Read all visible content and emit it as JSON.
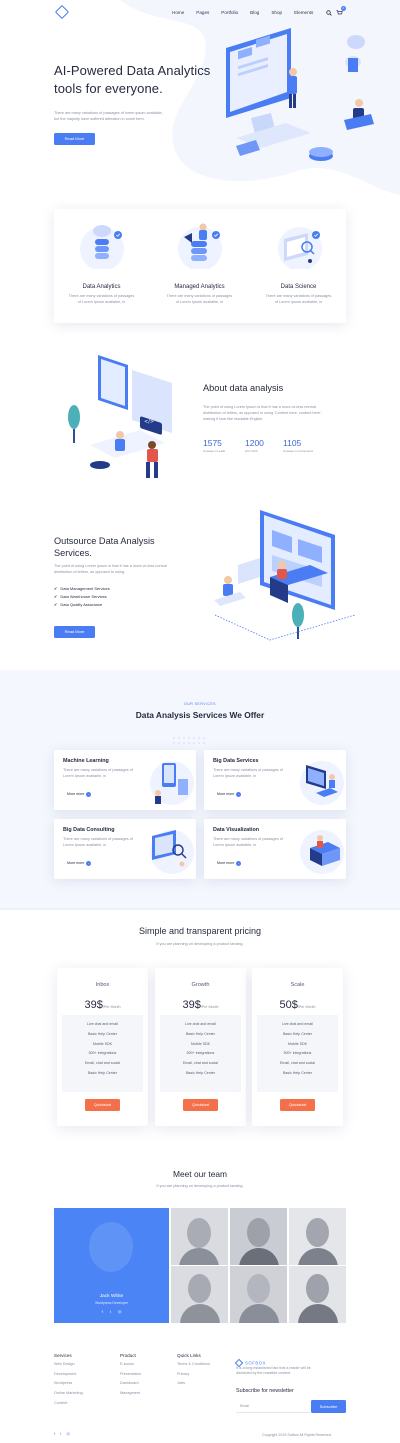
{
  "nav": {
    "menu": [
      "Home",
      "Pages",
      "Portfolio",
      "Blog",
      "Shop",
      "Elements"
    ],
    "cart_count": "0"
  },
  "hero": {
    "title_line1": "AI-Powered Data Analytics",
    "title_line2": "tools for everyone.",
    "desc_line1": "There are many variations of passages of lorem ipsum available,",
    "desc_line2": "but the majority have suffered alteration in some form.",
    "cta": "Read More"
  },
  "features": [
    {
      "title": "Data Analytics",
      "desc1": "There are many variations of passages",
      "desc2": "of Lorem Ipsum available, in"
    },
    {
      "title": "Managed Analytics",
      "desc1": "There are many variations of passages",
      "desc2": "of Lorem Ipsum available, in"
    },
    {
      "title": "Data Science",
      "desc1": "There are many variations of passages",
      "desc2": "of Lorem Ipsum available, in"
    }
  ],
  "about": {
    "title": "About data analysis",
    "desc1": "The point of using Lorem Ipsum is that it has a more-or-less normal",
    "desc2": "distribution of letters, as opposed to using 'Content here, content here',",
    "desc3": "making it look like readable English.",
    "stats": [
      {
        "value": "1575",
        "label": "Increase in Leads"
      },
      {
        "value": "1200",
        "label": "Lift in ROI"
      },
      {
        "value": "1105",
        "label": "Increase in Conversions"
      }
    ]
  },
  "outsource": {
    "title_line1": "Outsource Data Analysis",
    "title_line2": "Services.",
    "desc1": "The point of using Lorem Ipsum is that it has a more-or-less normal",
    "desc2": "distribution of letters, as opposed to using.",
    "checks": [
      "Data Management Services",
      "Data Warehouse Services",
      "Data Quality Assurance"
    ],
    "cta": "Read More"
  },
  "services": {
    "eyebrow": "OUR SERVICES",
    "title": "Data Analysis Services We Offer",
    "items": [
      {
        "title": "Machine Learning",
        "desc1": "There are many variations of passages of",
        "desc2": "Lorem Ipsum available, in",
        "link": "More more"
      },
      {
        "title": "Big Data Services",
        "desc1": "There are many variations of passages of",
        "desc2": "Lorem Ipsum available, in",
        "link": "More more"
      },
      {
        "title": "Big Data Consulting",
        "desc1": "There are many variations of passages of",
        "desc2": "Lorem Ipsum available, in",
        "link": "More more"
      },
      {
        "title": "Data Visualization",
        "desc1": "There are many variations of passages of",
        "desc2": "Lorem Ipsum available, in",
        "link": "More more"
      }
    ]
  },
  "pricing": {
    "title": "Simple and transparent pricing",
    "subtitle": "If you are planning on developing a product landing.",
    "plans": [
      {
        "name": "Inbox",
        "price": "39$",
        "period": "/Per Month",
        "cta": "Quickstart"
      },
      {
        "name": "Growth",
        "price": "39$",
        "period": "/Per Month",
        "cta": "Quickstart"
      },
      {
        "name": "Scale",
        "price": "50$",
        "period": "/Per Month",
        "cta": "Quickstart"
      }
    ],
    "features": [
      "Live chat and email",
      "Basic Help Center",
      "Mobile SDK",
      "500+ integrations",
      "Email, chat and social",
      "Basic Help Center"
    ]
  },
  "team": {
    "title": "Meet our team",
    "subtitle": "If you are planning on developing a product landing.",
    "featured_name": "Jack White",
    "featured_role": "Wordpress Developer"
  },
  "footer": {
    "columns": [
      {
        "title": "Services",
        "links": [
          "Web Design",
          "Development",
          "Wordpress",
          "Online Marketing",
          "Content"
        ]
      },
      {
        "title": "Product",
        "links": [
          "E-books",
          "Presentation",
          "Dashboard",
          "Managment"
        ]
      },
      {
        "title": "Quick Links",
        "links": [
          "Terms & Conditions",
          "Privacy",
          "Jobs"
        ]
      }
    ],
    "brand": "SOFBOX",
    "brand_desc1": "It is a long established fact that a reader will be",
    "brand_desc2": "distracted by the readable content.",
    "newsletter_title": "Subscribe for newsletter",
    "email_placeholder": "Email",
    "subscribe": "Subscribe",
    "copyright": "Copyright 2019 Sofbox All Rights Reserved."
  },
  "colors": {
    "accent": "#4a7cf3",
    "orange": "#f4704a",
    "dark": "#262b3f"
  }
}
